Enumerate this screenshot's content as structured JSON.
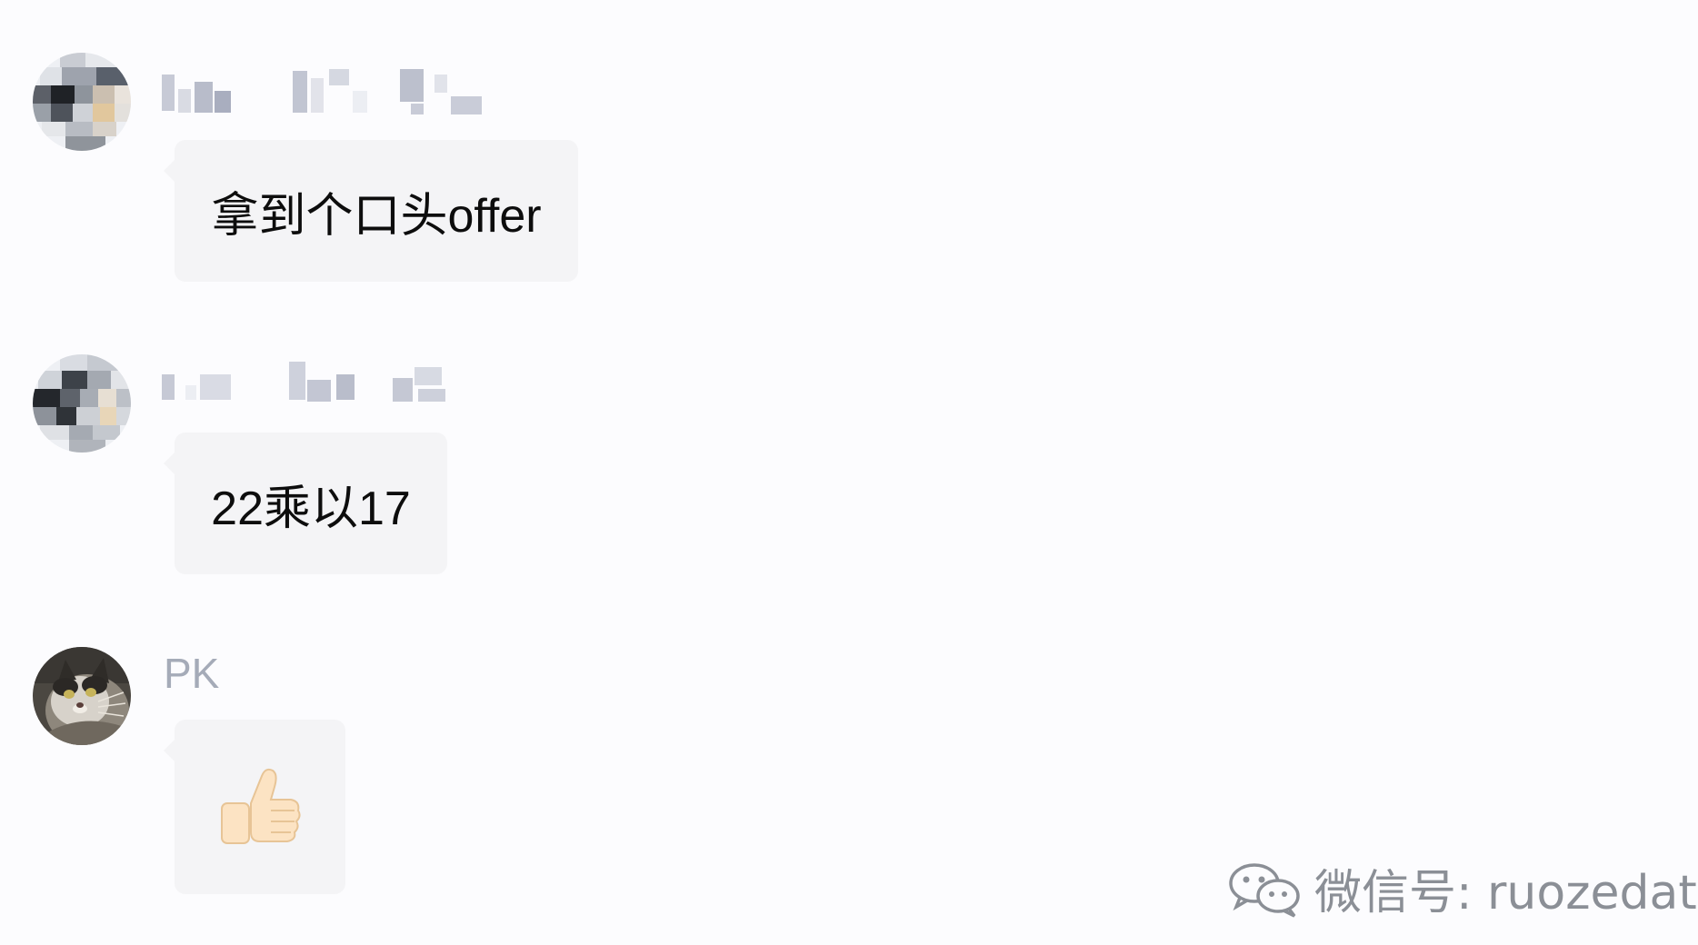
{
  "chat": {
    "messages": [
      {
        "sender": "",
        "sender_redacted": true,
        "text": "拿到个口头offer",
        "avatar": "pixelated-avatar-icon"
      },
      {
        "sender": "",
        "sender_redacted": true,
        "text": "22乘以17",
        "avatar": "pixelated-avatar-icon"
      },
      {
        "sender": "PK",
        "sender_redacted": false,
        "text": "👍",
        "avatar": "cat-avatar-icon"
      }
    ]
  },
  "watermark": {
    "label": "微信号: ruozedata",
    "icon": "wechat-icon"
  },
  "colors": {
    "background": "#fcfcfe",
    "bubble": "#f4f4f6",
    "sender_name": "#a5abb8",
    "message_text": "#0d0d0d",
    "watermark": "#8b8f96"
  }
}
